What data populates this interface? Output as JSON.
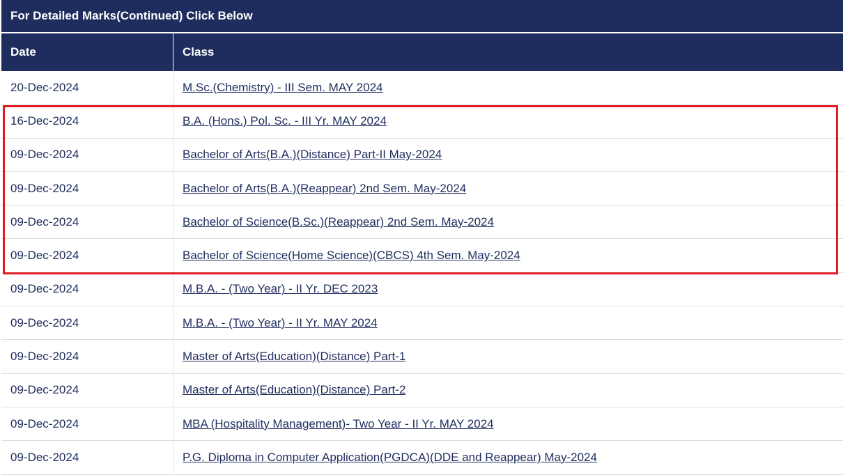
{
  "banner": {
    "text": "For Detailed Marks(Continued) Click Below"
  },
  "table": {
    "headers": {
      "date": "Date",
      "class": "Class"
    },
    "rows": [
      {
        "date": "20-Dec-2024",
        "class": "M.Sc.(Chemistry) - III Sem. MAY 2024"
      },
      {
        "date": "16-Dec-2024",
        "class": "B.A. (Hons.) Pol. Sc. - III Yr. MAY 2024"
      },
      {
        "date": "09-Dec-2024",
        "class": "Bachelor of Arts(B.A.)(Distance) Part-II May-2024"
      },
      {
        "date": "09-Dec-2024",
        "class": "Bachelor of Arts(B.A.)(Reappear) 2nd Sem. May-2024"
      },
      {
        "date": "09-Dec-2024",
        "class": "Bachelor of Science(B.Sc.)(Reappear) 2nd Sem. May-2024"
      },
      {
        "date": "09-Dec-2024",
        "class": "Bachelor of Science(Home Science)(CBCS) 4th Sem. May-2024"
      },
      {
        "date": "09-Dec-2024",
        "class": "M.B.A. - (Two Year) - II Yr. DEC 2023"
      },
      {
        "date": "09-Dec-2024",
        "class": "M.B.A. - (Two Year) - II Yr. MAY 2024"
      },
      {
        "date": "09-Dec-2024",
        "class": "Master of Arts(Education)(Distance) Part-1"
      },
      {
        "date": "09-Dec-2024",
        "class": "Master of Arts(Education)(Distance) Part-2"
      },
      {
        "date": "09-Dec-2024",
        "class": "MBA (Hospitality Management)- Two Year - II Yr. MAY 2024"
      },
      {
        "date": "09-Dec-2024",
        "class": "P.G. Diploma in Computer Application(PGDCA)(DDE and Reappear) May-2024"
      }
    ]
  },
  "colors": {
    "header_bg": "#1f2d5e",
    "link": "#1f2d5e",
    "highlight": "#e01b24"
  }
}
